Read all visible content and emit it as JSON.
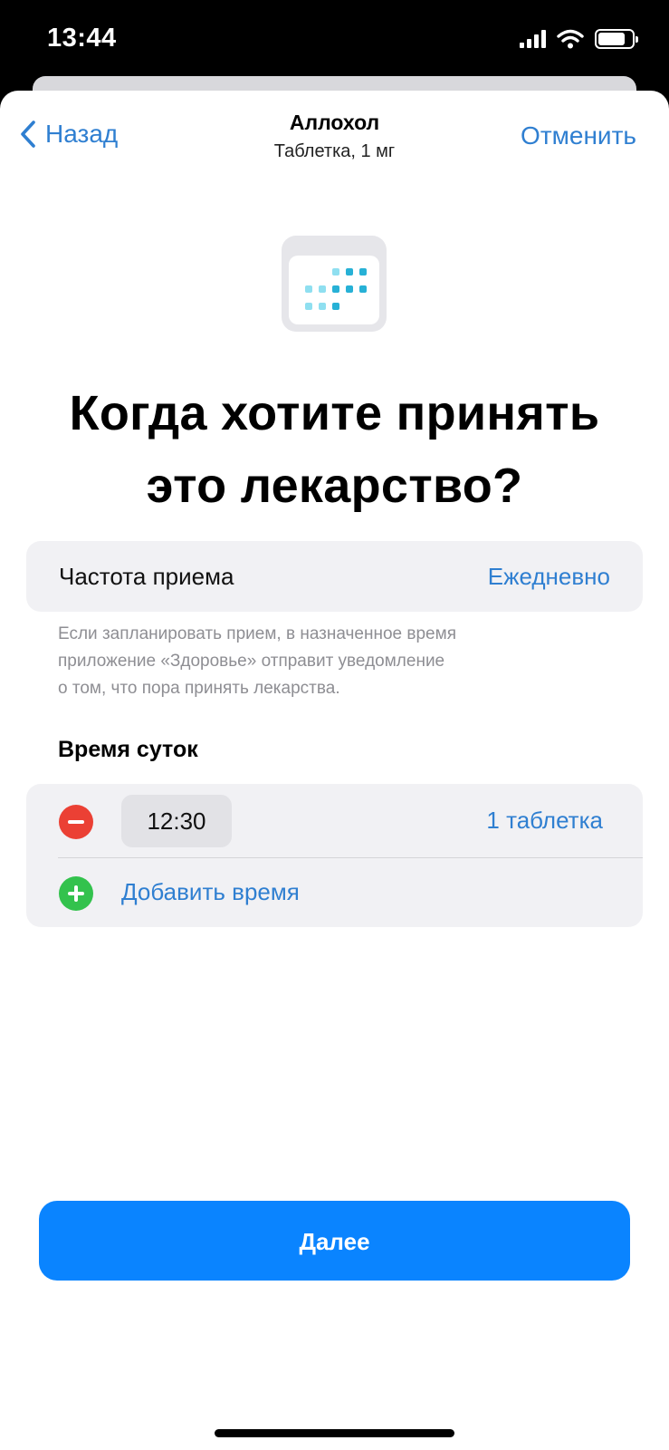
{
  "status_bar": {
    "time": "13:44",
    "battery_level": 0.8
  },
  "nav": {
    "back_label": "Назад",
    "title": "Аллохол",
    "subtitle": "Таблетка, 1 мг",
    "cancel_label": "Отменить"
  },
  "header": {
    "icon": "calendar-icon",
    "headline_line1": "Когда хотите принять",
    "headline_line2": "это лекарство?"
  },
  "frequency": {
    "label": "Частота приема",
    "value": "Ежедневно"
  },
  "footnote": {
    "line1": "Если запланировать прием, в назначенное время",
    "line2": "приложение «Здоровье» отправит уведомление",
    "line3": "о том, что пора принять лекарства."
  },
  "time_of_day": {
    "section_title": "Время суток",
    "times": [
      {
        "time": "12:30",
        "dose": "1 таблетка"
      }
    ],
    "add_label": "Добавить время"
  },
  "footer": {
    "next_label": "Далее"
  },
  "colors": {
    "accent": "#2f7fd1",
    "button": "#0a84ff",
    "remove": "#eb4034",
    "add": "#33c24d",
    "calendar_dot_light": "#8fdff0",
    "calendar_dot_dark": "#27b1d6"
  }
}
